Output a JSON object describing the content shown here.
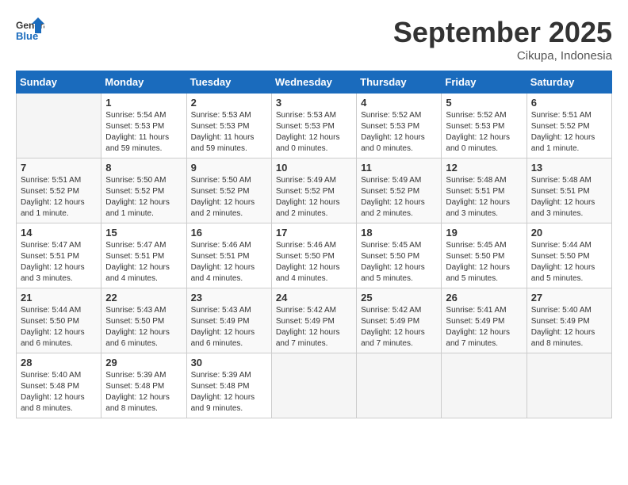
{
  "header": {
    "logo_line1": "General",
    "logo_line2": "Blue",
    "month": "September 2025",
    "location": "Cikupa, Indonesia"
  },
  "weekdays": [
    "Sunday",
    "Monday",
    "Tuesday",
    "Wednesday",
    "Thursday",
    "Friday",
    "Saturday"
  ],
  "weeks": [
    [
      {
        "day": "",
        "info": ""
      },
      {
        "day": "1",
        "info": "Sunrise: 5:54 AM\nSunset: 5:53 PM\nDaylight: 11 hours\nand 59 minutes."
      },
      {
        "day": "2",
        "info": "Sunrise: 5:53 AM\nSunset: 5:53 PM\nDaylight: 11 hours\nand 59 minutes."
      },
      {
        "day": "3",
        "info": "Sunrise: 5:53 AM\nSunset: 5:53 PM\nDaylight: 12 hours\nand 0 minutes."
      },
      {
        "day": "4",
        "info": "Sunrise: 5:52 AM\nSunset: 5:53 PM\nDaylight: 12 hours\nand 0 minutes."
      },
      {
        "day": "5",
        "info": "Sunrise: 5:52 AM\nSunset: 5:53 PM\nDaylight: 12 hours\nand 0 minutes."
      },
      {
        "day": "6",
        "info": "Sunrise: 5:51 AM\nSunset: 5:52 PM\nDaylight: 12 hours\nand 1 minute."
      }
    ],
    [
      {
        "day": "7",
        "info": "Sunrise: 5:51 AM\nSunset: 5:52 PM\nDaylight: 12 hours\nand 1 minute."
      },
      {
        "day": "8",
        "info": "Sunrise: 5:50 AM\nSunset: 5:52 PM\nDaylight: 12 hours\nand 1 minute."
      },
      {
        "day": "9",
        "info": "Sunrise: 5:50 AM\nSunset: 5:52 PM\nDaylight: 12 hours\nand 2 minutes."
      },
      {
        "day": "10",
        "info": "Sunrise: 5:49 AM\nSunset: 5:52 PM\nDaylight: 12 hours\nand 2 minutes."
      },
      {
        "day": "11",
        "info": "Sunrise: 5:49 AM\nSunset: 5:52 PM\nDaylight: 12 hours\nand 2 minutes."
      },
      {
        "day": "12",
        "info": "Sunrise: 5:48 AM\nSunset: 5:51 PM\nDaylight: 12 hours\nand 3 minutes."
      },
      {
        "day": "13",
        "info": "Sunrise: 5:48 AM\nSunset: 5:51 PM\nDaylight: 12 hours\nand 3 minutes."
      }
    ],
    [
      {
        "day": "14",
        "info": "Sunrise: 5:47 AM\nSunset: 5:51 PM\nDaylight: 12 hours\nand 3 minutes."
      },
      {
        "day": "15",
        "info": "Sunrise: 5:47 AM\nSunset: 5:51 PM\nDaylight: 12 hours\nand 4 minutes."
      },
      {
        "day": "16",
        "info": "Sunrise: 5:46 AM\nSunset: 5:51 PM\nDaylight: 12 hours\nand 4 minutes."
      },
      {
        "day": "17",
        "info": "Sunrise: 5:46 AM\nSunset: 5:50 PM\nDaylight: 12 hours\nand 4 minutes."
      },
      {
        "day": "18",
        "info": "Sunrise: 5:45 AM\nSunset: 5:50 PM\nDaylight: 12 hours\nand 5 minutes."
      },
      {
        "day": "19",
        "info": "Sunrise: 5:45 AM\nSunset: 5:50 PM\nDaylight: 12 hours\nand 5 minutes."
      },
      {
        "day": "20",
        "info": "Sunrise: 5:44 AM\nSunset: 5:50 PM\nDaylight: 12 hours\nand 5 minutes."
      }
    ],
    [
      {
        "day": "21",
        "info": "Sunrise: 5:44 AM\nSunset: 5:50 PM\nDaylight: 12 hours\nand 6 minutes."
      },
      {
        "day": "22",
        "info": "Sunrise: 5:43 AM\nSunset: 5:50 PM\nDaylight: 12 hours\nand 6 minutes."
      },
      {
        "day": "23",
        "info": "Sunrise: 5:43 AM\nSunset: 5:49 PM\nDaylight: 12 hours\nand 6 minutes."
      },
      {
        "day": "24",
        "info": "Sunrise: 5:42 AM\nSunset: 5:49 PM\nDaylight: 12 hours\nand 7 minutes."
      },
      {
        "day": "25",
        "info": "Sunrise: 5:42 AM\nSunset: 5:49 PM\nDaylight: 12 hours\nand 7 minutes."
      },
      {
        "day": "26",
        "info": "Sunrise: 5:41 AM\nSunset: 5:49 PM\nDaylight: 12 hours\nand 7 minutes."
      },
      {
        "day": "27",
        "info": "Sunrise: 5:40 AM\nSunset: 5:49 PM\nDaylight: 12 hours\nand 8 minutes."
      }
    ],
    [
      {
        "day": "28",
        "info": "Sunrise: 5:40 AM\nSunset: 5:48 PM\nDaylight: 12 hours\nand 8 minutes."
      },
      {
        "day": "29",
        "info": "Sunrise: 5:39 AM\nSunset: 5:48 PM\nDaylight: 12 hours\nand 8 minutes."
      },
      {
        "day": "30",
        "info": "Sunrise: 5:39 AM\nSunset: 5:48 PM\nDaylight: 12 hours\nand 9 minutes."
      },
      {
        "day": "",
        "info": ""
      },
      {
        "day": "",
        "info": ""
      },
      {
        "day": "",
        "info": ""
      },
      {
        "day": "",
        "info": ""
      }
    ]
  ]
}
